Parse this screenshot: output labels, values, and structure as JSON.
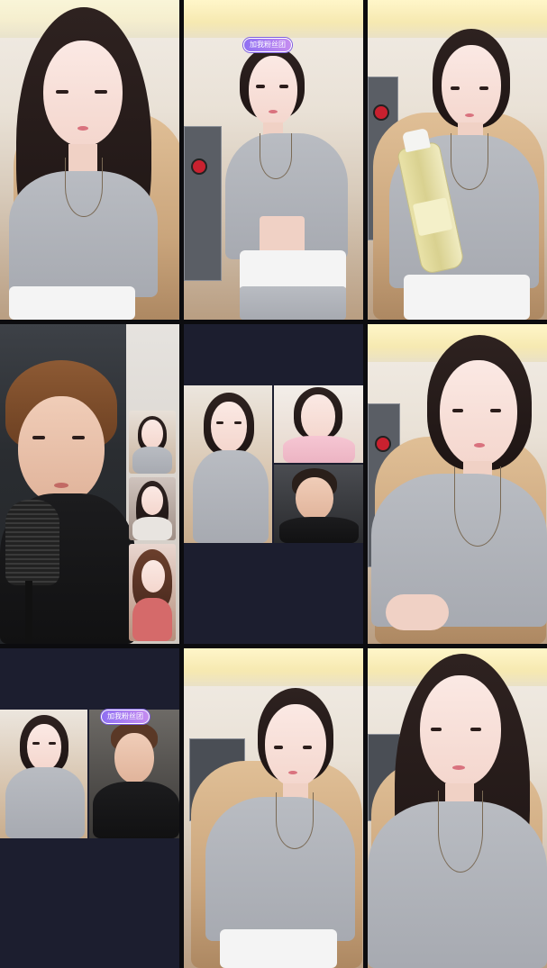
{
  "layout": {
    "type": "video-grid",
    "rows": 3,
    "cols": 3
  },
  "badges": {
    "tile2": "加我粉丝团",
    "tile7": "加我粉丝团"
  },
  "colors": {
    "grid_background": "#0c0c0f",
    "panel_navy": "#1c1e2f",
    "badge_purple": "#8f6ff2"
  },
  "icons": {
    "microphone": "microphone-icon",
    "bottle": "drink-bottle"
  }
}
